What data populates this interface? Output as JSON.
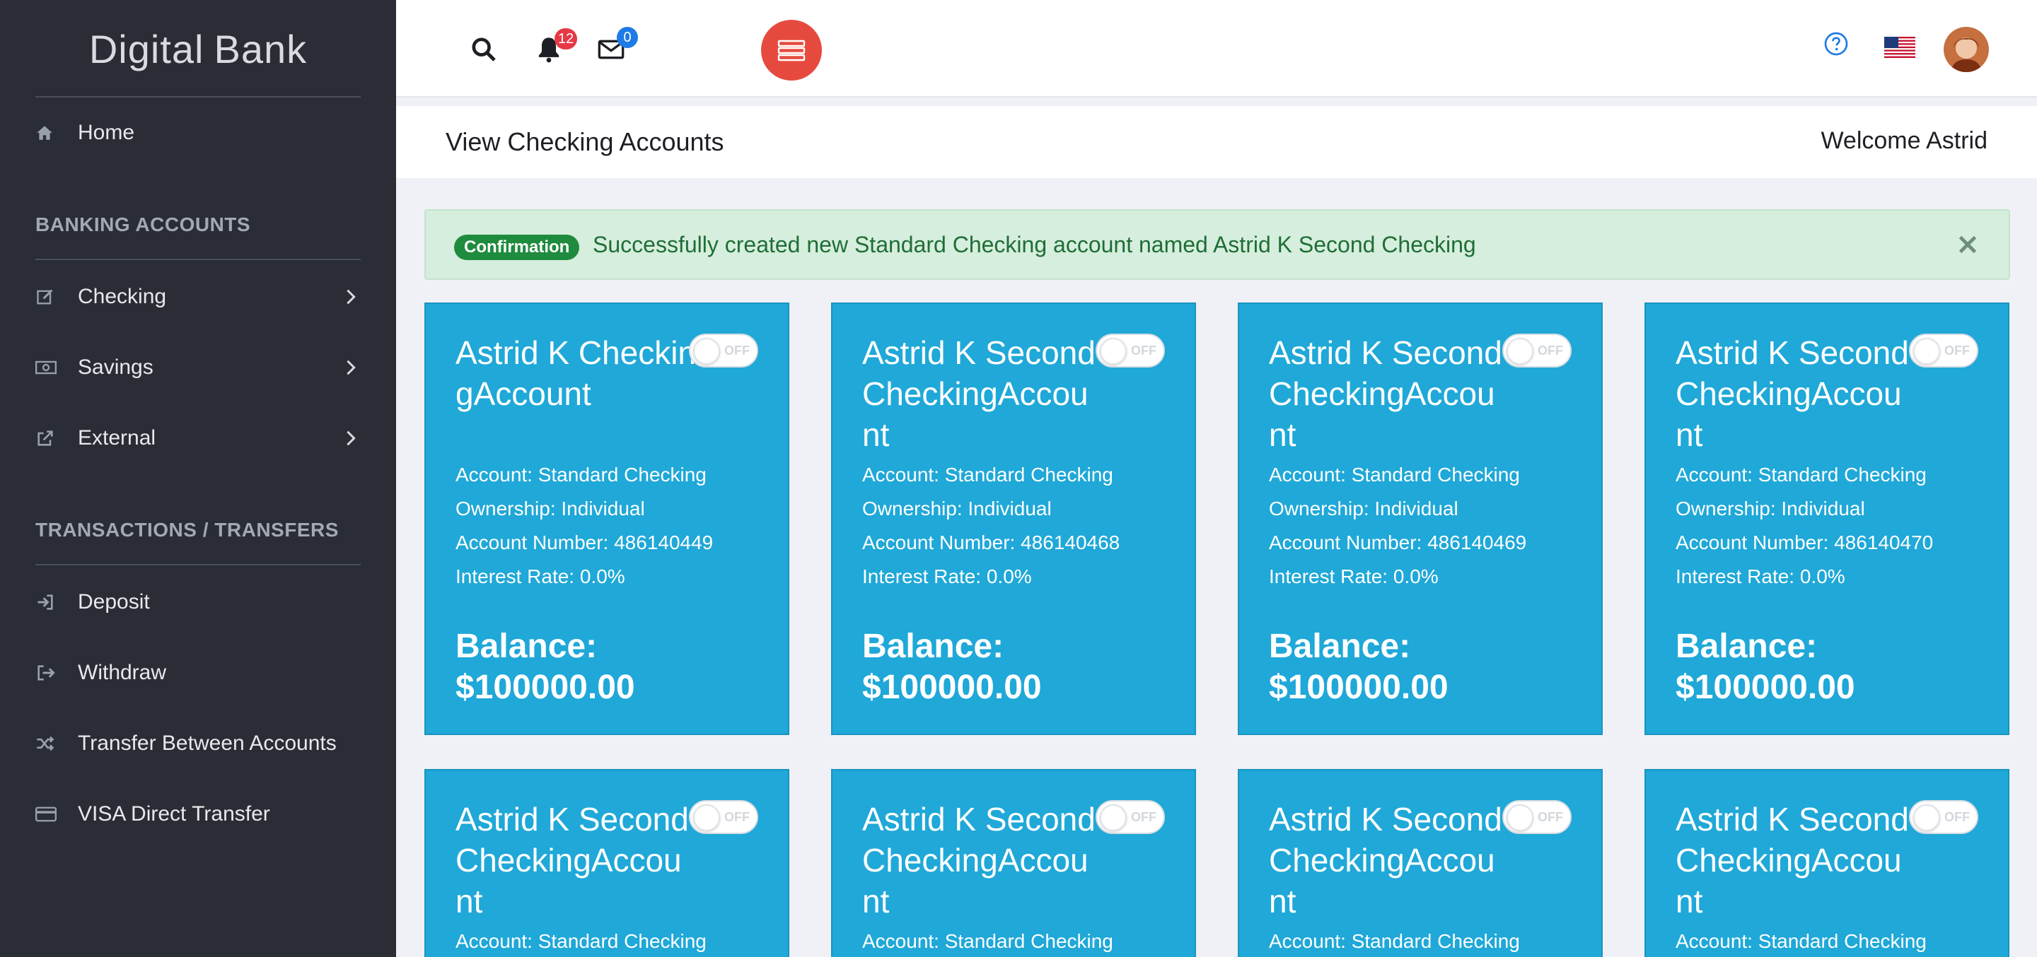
{
  "brand": {
    "part1": "Digital",
    "part2": "Bank"
  },
  "sidebar": {
    "home": "Home",
    "section_banking": "BANKING ACCOUNTS",
    "checking": "Checking",
    "savings": "Savings",
    "external": "External",
    "section_transactions": "TRANSACTIONS / TRANSFERS",
    "deposit": "Deposit",
    "withdraw": "Withdraw",
    "transfer": "Transfer Between Accounts",
    "visa": "VISA Direct Transfer"
  },
  "topbar": {
    "notifications_count": "12",
    "messages_count": "0"
  },
  "header": {
    "title": "View Checking Accounts",
    "welcome": "Welcome Astrid"
  },
  "alert": {
    "badge": "Confirmation",
    "message": "Successfully created new Standard Checking account named Astrid K Second Checking"
  },
  "toggle_label": "OFF",
  "cards": [
    {
      "name": "Astrid K CheckingAccount",
      "account": "Account: Standard Checking",
      "ownership": "Ownership: Individual",
      "number": "Account Number: 486140449",
      "rate": "Interest Rate: 0.0%",
      "balance_label": "Balance:",
      "balance": "$100000.00"
    },
    {
      "name": "Astrid K Second CheckingAccount",
      "account": "Account: Standard Checking",
      "ownership": "Ownership: Individual",
      "number": "Account Number: 486140468",
      "rate": "Interest Rate: 0.0%",
      "balance_label": "Balance:",
      "balance": "$100000.00"
    },
    {
      "name": "Astrid K Second CheckingAccount",
      "account": "Account: Standard Checking",
      "ownership": "Ownership: Individual",
      "number": "Account Number: 486140469",
      "rate": "Interest Rate: 0.0%",
      "balance_label": "Balance:",
      "balance": "$100000.00"
    },
    {
      "name": "Astrid K Second CheckingAccount",
      "account": "Account: Standard Checking",
      "ownership": "Ownership: Individual",
      "number": "Account Number: 486140470",
      "rate": "Interest Rate: 0.0%",
      "balance_label": "Balance:",
      "balance": "$100000.00"
    },
    {
      "name": "Astrid K Second CheckingAccount",
      "account": "Account: Standard Checking"
    },
    {
      "name": "Astrid K Second CheckingAccount",
      "account": "Account: Standard Checking"
    },
    {
      "name": "Astrid K Second CheckingAccount",
      "account": "Account: Standard Checking"
    },
    {
      "name": "Astrid K Second CheckingAccount",
      "account": "Account: Standard Checking"
    }
  ],
  "colors": {
    "sidebar_bg": "#2a2d35",
    "card_bg": "#1fa8d8",
    "menu_button": "#e64a3f",
    "alert_bg": "#d6eedd",
    "badge_green": "#1f8b3e"
  }
}
